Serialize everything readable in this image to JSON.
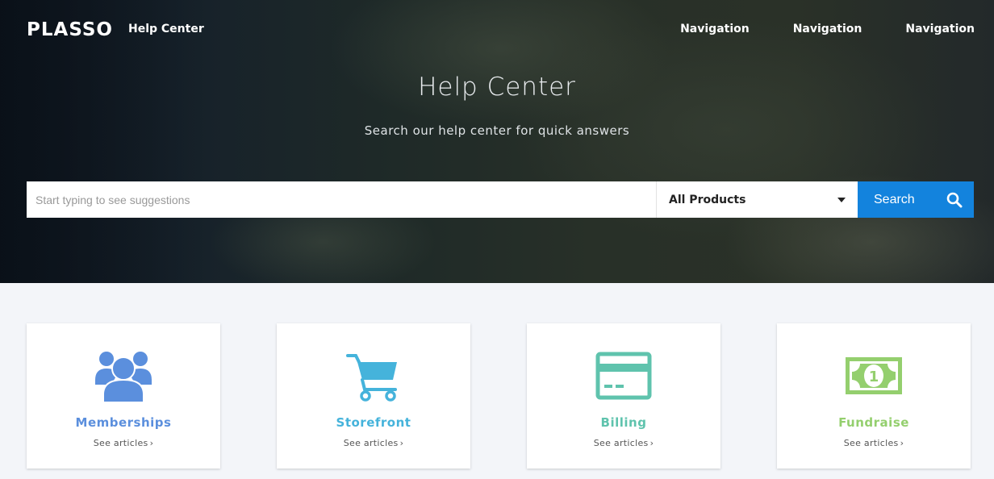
{
  "header": {
    "logo": "PLASSO",
    "logo_sub": "Help Center",
    "nav": [
      "Navigation",
      "Navigation",
      "Navigation"
    ]
  },
  "hero": {
    "title": "Help Center",
    "subtitle": "Search our help center for quick answers"
  },
  "search": {
    "placeholder": "Start typing to see suggestions",
    "value": "",
    "product_selected": "All Products",
    "button_label": "Search"
  },
  "categories": [
    {
      "title": "Memberships",
      "link": "See articles",
      "icon": "users-group-icon",
      "color": "#5b8fdd"
    },
    {
      "title": "Storefront",
      "link": "See articles",
      "icon": "shopping-cart-icon",
      "color": "#45b3db"
    },
    {
      "title": "Billing",
      "link": "See articles",
      "icon": "credit-card-icon",
      "color": "#5fc3ad"
    },
    {
      "title": "Fundraise",
      "link": "See articles",
      "icon": "money-bill-icon",
      "color": "#94cf6e"
    }
  ],
  "colors": {
    "accent": "#1383dd",
    "page_bg": "#f3f5f9"
  }
}
